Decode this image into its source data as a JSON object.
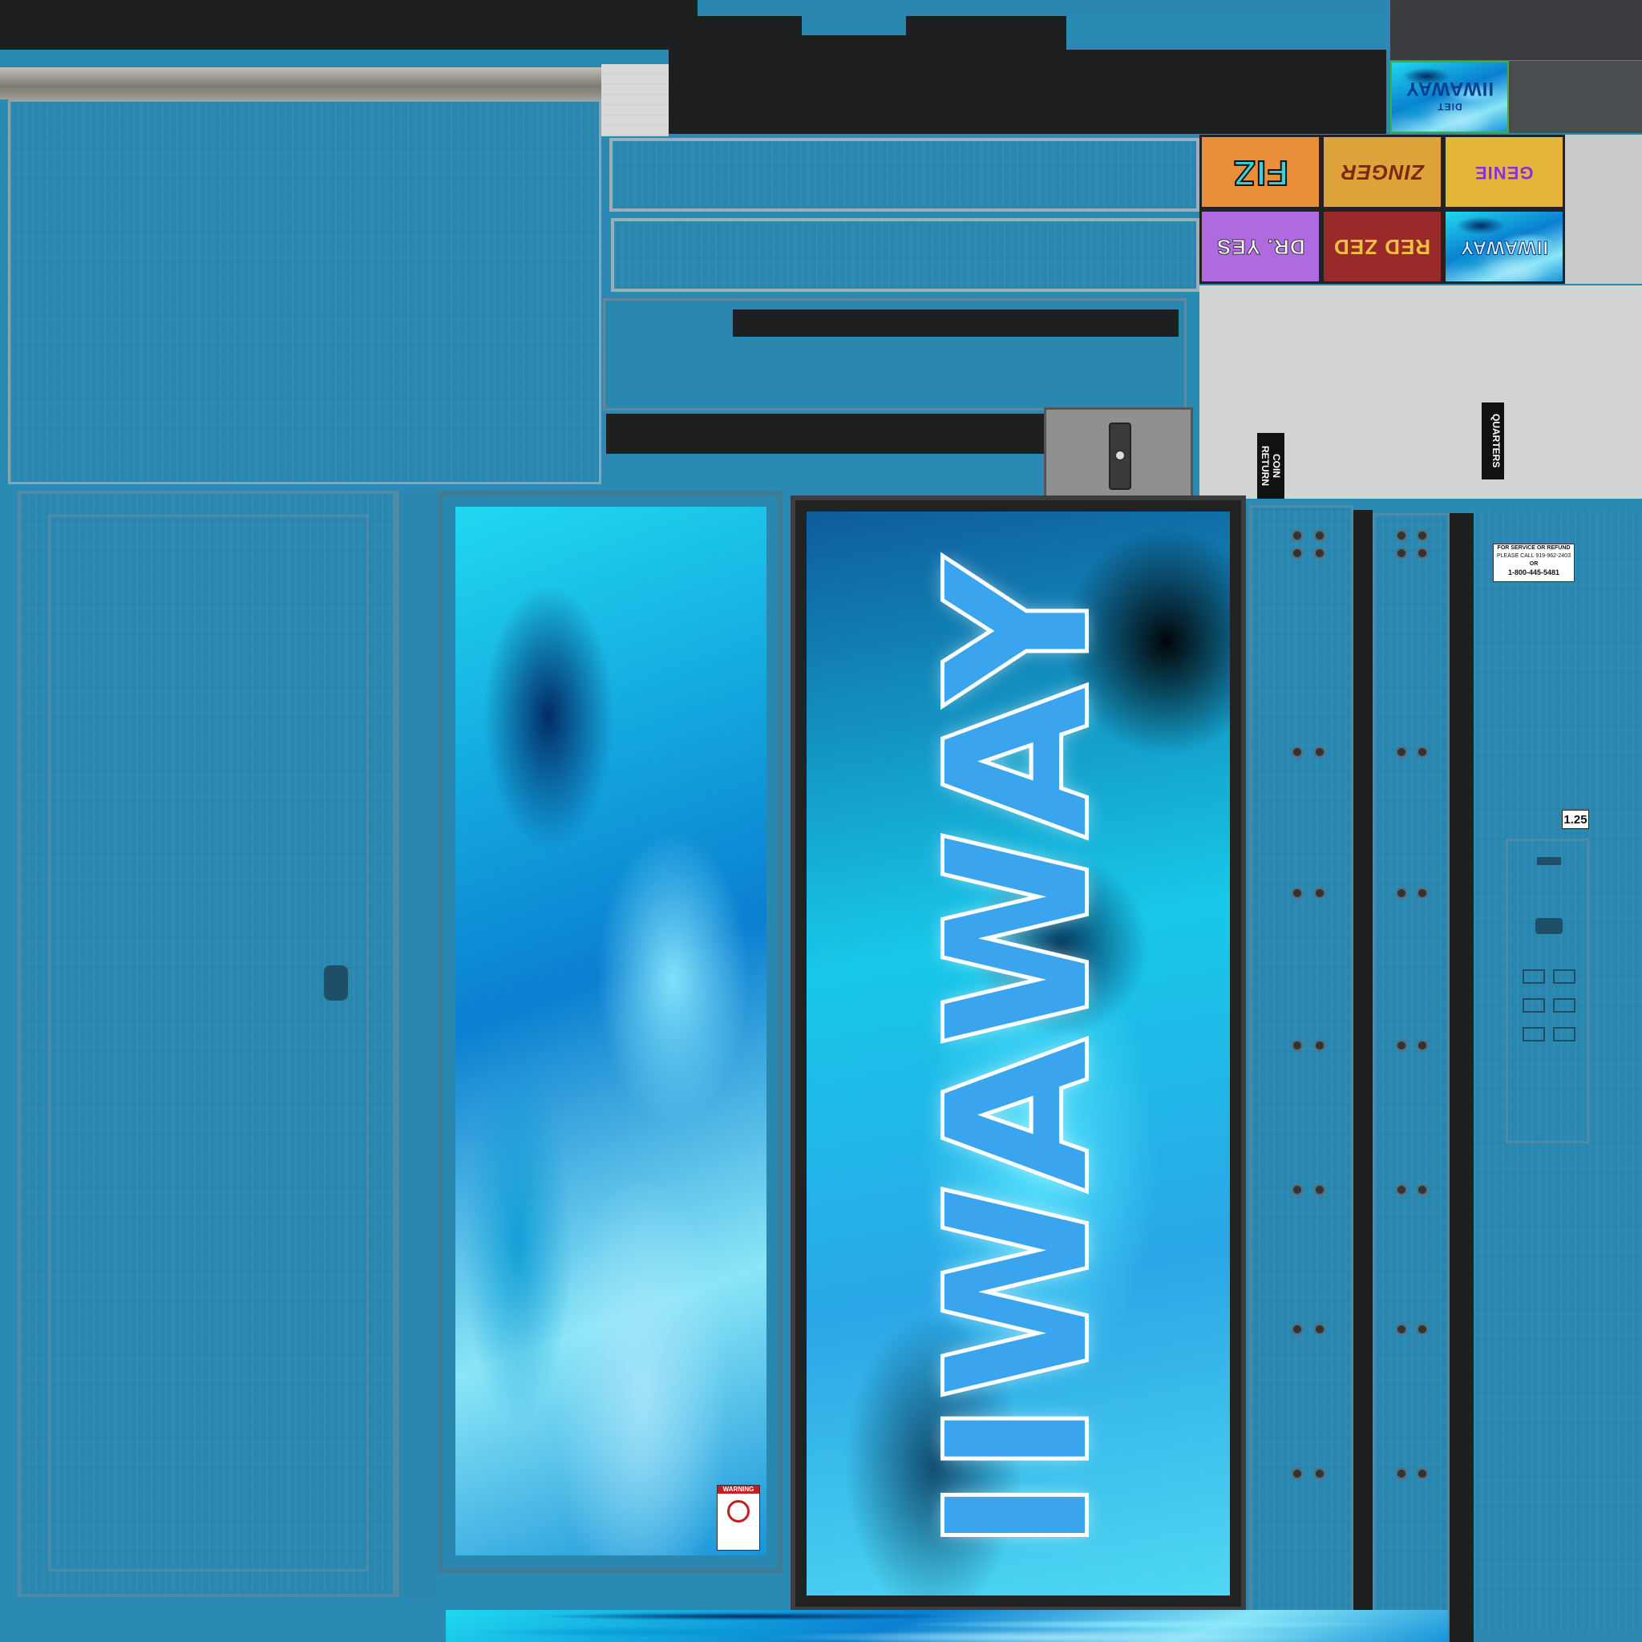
{
  "texture": {
    "brand": "IIWAWAY",
    "colors": {
      "body_blue": "#2a87b0",
      "trim_dark": "#1e1f21",
      "metal_grey": "#d8d8d8",
      "logo_blue": "#3aa5ee"
    }
  },
  "flavor_tiles": [
    {
      "label": "FIZ",
      "bg": "#e98f3a",
      "fg": "#38d1d6"
    },
    {
      "label": "ZINGER",
      "bg": "#e0a23a",
      "fg": "#7a2a10"
    },
    {
      "label": "GENIE",
      "bg": "#e4b73a",
      "fg": "#8b2fd6"
    },
    {
      "label": "DR. YES",
      "bg": "#b06ae0",
      "fg": "#ffffff"
    },
    {
      "label": "RED ZED",
      "bg": "#9a2a2a",
      "fg": "#f0c040"
    },
    {
      "label": "IIWAWAY",
      "bg": "#1aa0d8",
      "fg": "#e8f8ff"
    }
  ],
  "diet_tile": {
    "brand": "IIWAWAY",
    "sub": "DIET"
  },
  "coin_labels": {
    "coin_return": "COIN RETURN",
    "quarters": "QUARTERS"
  },
  "service_sticker": {
    "line1": "FOR SERVICE OR REFUND",
    "line2": "PLEASE CALL 919-962-2403",
    "line3": "OR",
    "line4": "1-800-445-5481"
  },
  "price_tag": "1.25",
  "warning_sticker": "WARNING"
}
